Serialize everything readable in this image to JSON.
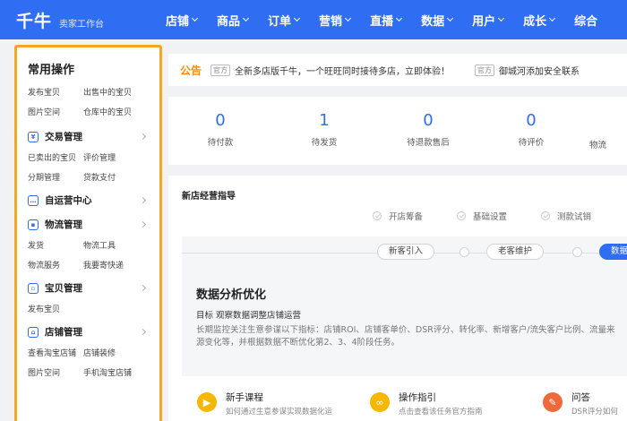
{
  "brand": {
    "logo": "千牛",
    "subtitle": "卖家工作台"
  },
  "nav": [
    "店铺",
    "商品",
    "订单",
    "营销",
    "直播",
    "数据",
    "用户",
    "成长",
    "综合"
  ],
  "sidebar": {
    "title": "常用操作",
    "common_links": [
      "发布宝贝",
      "出售中的宝贝",
      "图片空间",
      "仓库中的宝贝"
    ],
    "sections": [
      {
        "title": "交易管理",
        "icon": "yen-icon",
        "links": [
          "已卖出的宝贝",
          "评价管理",
          "分期管理",
          "贷款支付"
        ]
      },
      {
        "title": "自运营中心",
        "icon": "chat-icon",
        "links": []
      },
      {
        "title": "物流管理",
        "icon": "truck-icon",
        "links": [
          "发货",
          "物流工具",
          "物流服务",
          "我要寄快递"
        ]
      },
      {
        "title": "宝贝管理",
        "icon": "box-icon",
        "links": [
          "发布宝贝"
        ]
      },
      {
        "title": "店铺管理",
        "icon": "shop-icon",
        "links": [
          "查看淘宝店铺",
          "店铺装修",
          "图片空间",
          "手机淘宝店铺"
        ]
      }
    ]
  },
  "notice": {
    "title": "公告",
    "tag": "官方",
    "items": [
      "全新多店版千牛，一个旺旺同时接待多店，立即体验！",
      "御城河添加安全联系"
    ]
  },
  "stats": [
    {
      "value": "0",
      "label": "待付款"
    },
    {
      "value": "1",
      "label": "待发货"
    },
    {
      "value": "0",
      "label": "待退款售后"
    },
    {
      "value": "0",
      "label": "待评价"
    },
    {
      "value": "",
      "label": "物流"
    }
  ],
  "guide": {
    "title": "新店经营指导",
    "steps": [
      "开店筹备",
      "基础设置",
      "测款试销"
    ],
    "pills": [
      "新客引入",
      "老客维护",
      "数据"
    ],
    "inner_title": "数据分析优化",
    "goal": "目标  观察数据调整店铺运营",
    "desc": "长期监控关注生意参谋以下指标：店铺ROI、店铺客单价、DSR评分、转化率、新增客户/流失客户比例、流量来源变化等，并根据数据不断优化第2、3、4阶段任务。",
    "features": [
      {
        "title": "新手课程",
        "sub": "如何通过生意参谋实现数据化运",
        "icon": "play-icon",
        "color": "#f5b700"
      },
      {
        "title": "操作指引",
        "sub": "点击查看该任务官方指南",
        "icon": "link-icon",
        "color": "#f5b700"
      },
      {
        "title": "问答",
        "sub": "DSR评分如何",
        "icon": "pen-icon",
        "color": "#f0693a"
      }
    ]
  }
}
